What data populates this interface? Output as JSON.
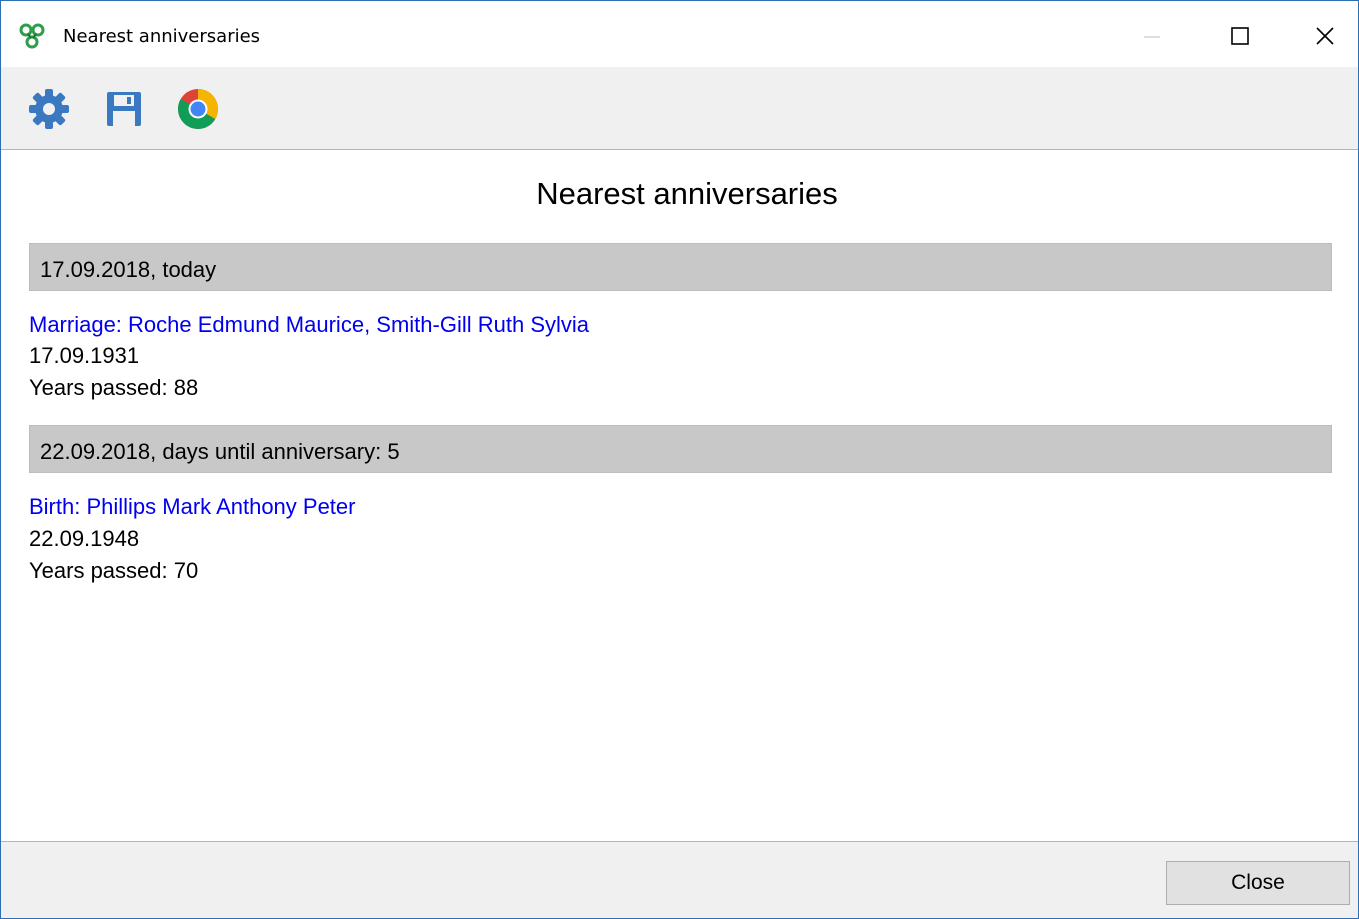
{
  "window": {
    "title": "Nearest anniversaries",
    "controls": {
      "minimize_icon": "minimize-icon",
      "maximize_icon": "maximize-icon",
      "close_icon": "close-icon"
    }
  },
  "toolbar": {
    "items": [
      {
        "icon": "gear-icon",
        "color": "#3a78c2"
      },
      {
        "icon": "save-icon",
        "color": "#3a78c2"
      },
      {
        "icon": "chrome-icon"
      }
    ]
  },
  "report": {
    "title": "Nearest anniversaries",
    "groups": [
      {
        "header": "17.09.2018, today",
        "event": {
          "prefix": "Marriage: ",
          "person1": "Roche Edmund Maurice",
          "separator": ", ",
          "person2": "Smith-Gill Ruth Sylvia",
          "date": "17.09.1931",
          "years": "Years passed: 88"
        }
      },
      {
        "header": "22.09.2018, days until anniversary: 5",
        "event": {
          "prefix": "Birth: ",
          "person1": "Phillips Mark Anthony Peter",
          "date": "22.09.1948",
          "years": "Years passed: 70"
        }
      }
    ]
  },
  "footer": {
    "close_label": "Close"
  },
  "colors": {
    "link": "#0000ee",
    "header_bg": "#c8c8c8",
    "toolbar_bg": "#f0f0f0",
    "window_border": "#2b6fb6"
  }
}
